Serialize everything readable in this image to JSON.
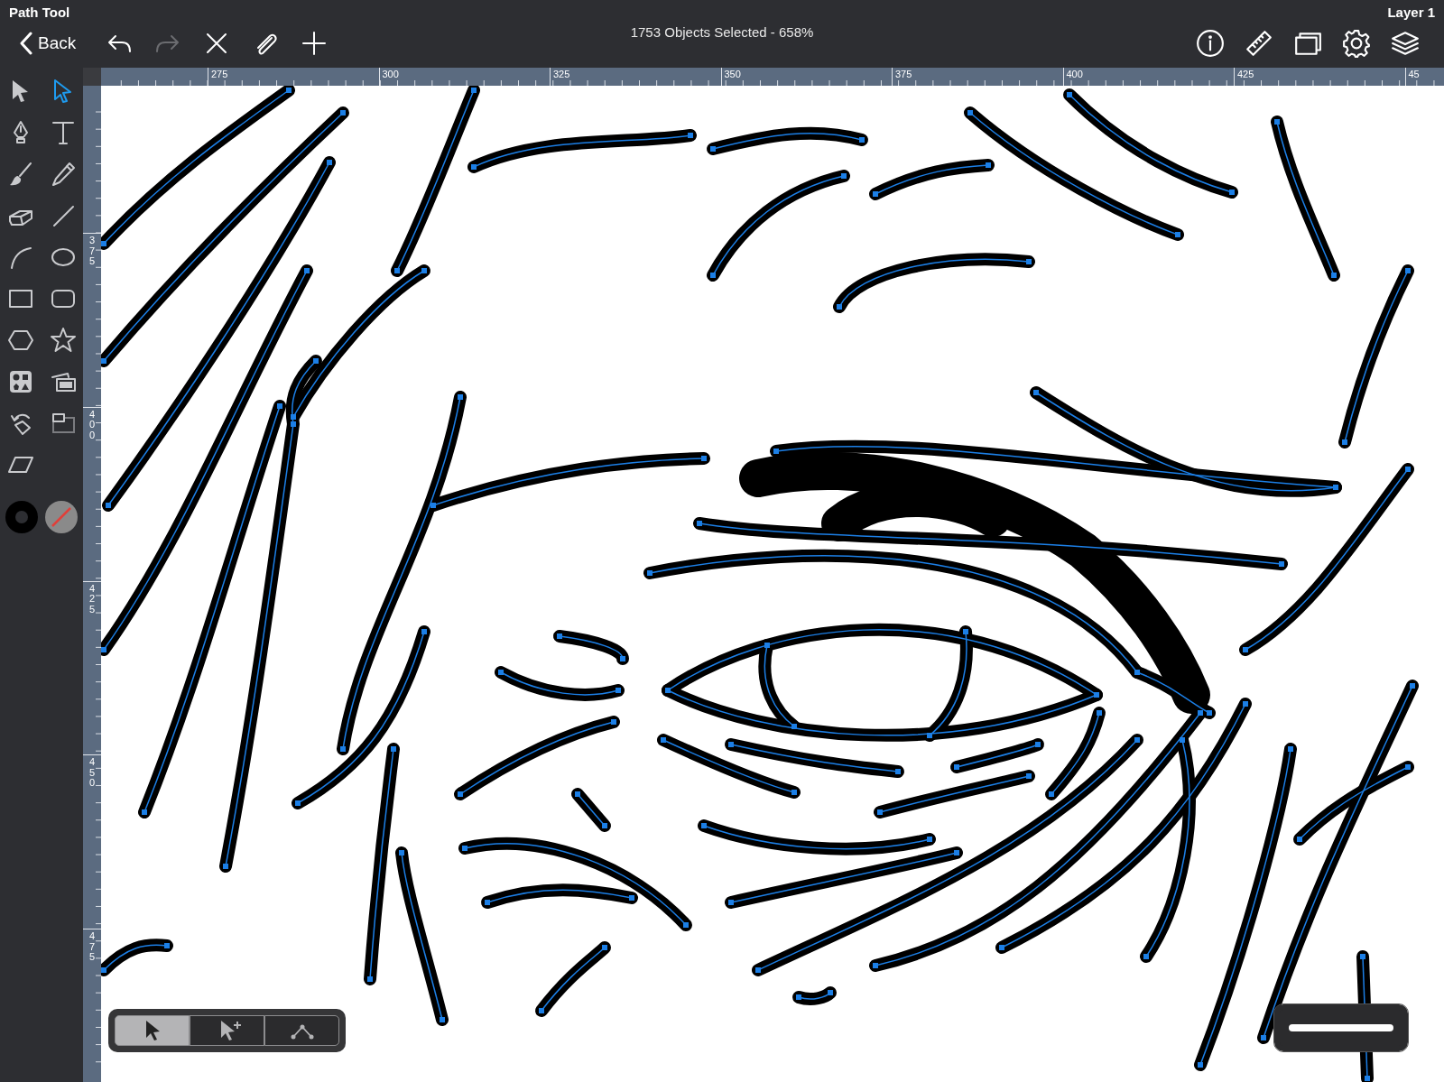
{
  "status_bar": {
    "tool": "Path Tool",
    "layer": "Layer 1"
  },
  "toolbar": {
    "back": "Back",
    "title": "1753 Objects Selected - 658%",
    "left_buttons": [
      {
        "kind": "undo",
        "disabled": false
      },
      {
        "kind": "redo",
        "disabled": true
      },
      {
        "kind": "close",
        "disabled": false
      },
      {
        "kind": "attach",
        "disabled": false
      },
      {
        "kind": "add",
        "disabled": false
      }
    ],
    "right_buttons": [
      {
        "kind": "info"
      },
      {
        "kind": "ruler"
      },
      {
        "kind": "windows"
      },
      {
        "kind": "settings"
      },
      {
        "kind": "layers"
      }
    ]
  },
  "rulers": {
    "horizontal": [
      "275",
      "300",
      "325",
      "350",
      "375",
      "400",
      "425",
      "45"
    ],
    "vertical": [
      "375",
      "400",
      "425",
      "450",
      "475"
    ]
  },
  "tools": [
    {
      "kind": "select",
      "selected": false
    },
    {
      "kind": "direct-select",
      "selected": true
    },
    {
      "kind": "pen",
      "selected": false
    },
    {
      "kind": "text",
      "selected": false
    },
    {
      "kind": "brush",
      "selected": false
    },
    {
      "kind": "pencil",
      "selected": false
    },
    {
      "kind": "eraser",
      "selected": false
    },
    {
      "kind": "line",
      "selected": false
    },
    {
      "kind": "arc",
      "selected": false
    },
    {
      "kind": "ellipse",
      "selected": false
    },
    {
      "kind": "rectangle",
      "selected": false
    },
    {
      "kind": "rounded-rectangle",
      "selected": false
    },
    {
      "kind": "hexagon",
      "selected": false
    },
    {
      "kind": "star",
      "selected": false
    },
    {
      "kind": "shapes",
      "selected": false
    },
    {
      "kind": "image",
      "selected": false
    },
    {
      "kind": "rotate",
      "selected": false
    },
    {
      "kind": "artboard",
      "selected": false
    },
    {
      "kind": "skew",
      "selected": false
    }
  ],
  "selection_modes": [
    {
      "kind": "select",
      "selected": true
    },
    {
      "kind": "add-select",
      "selected": false
    },
    {
      "kind": "node",
      "selected": false
    }
  ]
}
